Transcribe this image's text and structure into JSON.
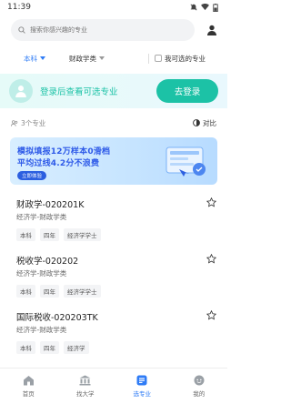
{
  "status": {
    "time": "11:39"
  },
  "search": {
    "placeholder": "搜索你感兴趣的专业"
  },
  "filters": {
    "level": "本科",
    "category": "财政学类",
    "only_selectable": "我可选的专业"
  },
  "login_banner": {
    "text": "登录后查看可选专业",
    "button": "去登录"
  },
  "count_bar": {
    "count_text": "3个专业",
    "compare": "对比"
  },
  "ad": {
    "line1": "模拟填报12万样本0滑档",
    "line2": "平均过线4.2分不浪费",
    "tag": "立即体验"
  },
  "majors": [
    {
      "name": "财政学-020201K",
      "sub": "经济学-财政学类",
      "tags": [
        "本科",
        "四年",
        "经济学学士"
      ]
    },
    {
      "name": "税收学-020202",
      "sub": "经济学-财政学类",
      "tags": [
        "本科",
        "四年",
        "经济学学士"
      ]
    },
    {
      "name": "国际税收-020203TK",
      "sub": "经济学-财政学类",
      "tags": [
        "本科",
        "四年",
        "经济学"
      ]
    }
  ],
  "tabs": [
    {
      "label": "首页",
      "icon": "home-icon"
    },
    {
      "label": "找大学",
      "icon": "university-icon"
    },
    {
      "label": "选专业",
      "icon": "major-icon"
    },
    {
      "label": "我的",
      "icon": "profile-icon"
    }
  ],
  "colors": {
    "accent": "#2f7cf6",
    "teal": "#1cc2a6"
  }
}
